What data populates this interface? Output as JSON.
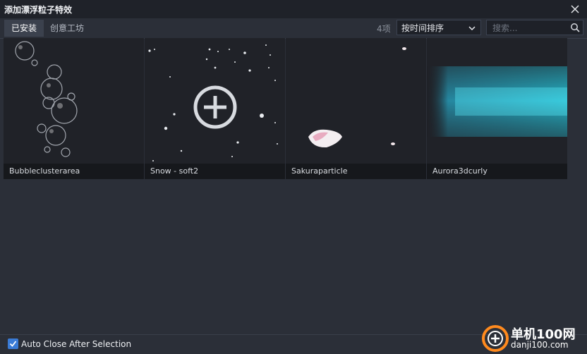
{
  "window": {
    "title": "添加漂浮粒子特效"
  },
  "tabs": [
    {
      "label": "已安装",
      "active": true
    },
    {
      "label": "创意工坊",
      "active": false
    }
  ],
  "toolbar": {
    "count": "4项",
    "sort_selected": "按时间排序",
    "search_placeholder": "搜索..."
  },
  "effects": [
    {
      "name": "Bubbleclusterarea"
    },
    {
      "name": "Snow - soft2"
    },
    {
      "name": "Sakuraparticle"
    },
    {
      "name": "Aurora3dcurly"
    }
  ],
  "footer": {
    "auto_close_label": "Auto Close After Selection",
    "auto_close_checked": true
  },
  "watermark": {
    "line1": "单机100网",
    "line2": "danji100.com"
  },
  "colors": {
    "accent": "#3a7bd5",
    "aurora": "#27e6ff"
  },
  "icons": [
    "close-icon",
    "chevron-down-icon",
    "search-icon",
    "plus-circle-icon",
    "checkmark-icon"
  ]
}
